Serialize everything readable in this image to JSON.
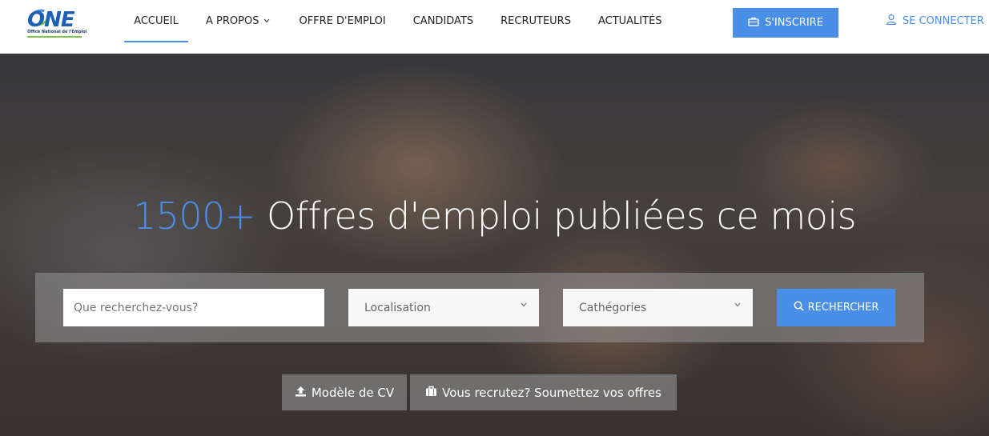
{
  "logo": {
    "mark": "ONE",
    "subtitle": "Office National de l'Emploi"
  },
  "nav": {
    "items": [
      {
        "label": "ACCUEIL",
        "active": true
      },
      {
        "label": "A PROPOS",
        "has_dropdown": true
      },
      {
        "label": "OFFRE D'EMPLOI"
      },
      {
        "label": "CANDIDATS"
      },
      {
        "label": "RECRUTEURS"
      },
      {
        "label": "ACTUALITÉS"
      }
    ],
    "register_label": "S'INSCRIRE",
    "login_label": "SE CONNECTER"
  },
  "hero": {
    "highlight": "1500+",
    "title_rest": " Offres d'emploi publiées ce mois"
  },
  "search": {
    "keyword_placeholder": "Que recherchez-vous?",
    "location_label": "Localisation",
    "category_label": "Cathégories",
    "button_label": "RECHERCHER"
  },
  "cta": {
    "cv_label": "Modèle de CV",
    "recruit_label": "Vous recrutez? Soumettez vos offres"
  },
  "colors": {
    "accent": "#4a8fe7",
    "logo_green": "#7cc242"
  },
  "icons": {
    "register": "briefcase-icon",
    "login": "user-icon",
    "search": "search-icon",
    "cv": "upload-icon",
    "recruit": "briefcase-icon",
    "dropdown": "chevron-down-icon"
  }
}
